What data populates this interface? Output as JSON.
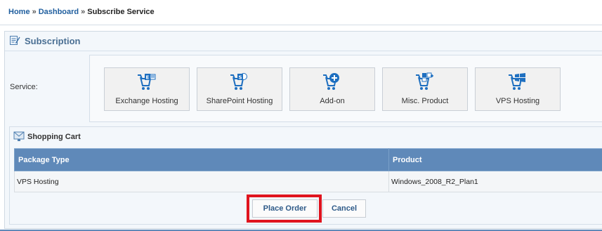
{
  "breadcrumb": {
    "home": "Home",
    "sep1": "»",
    "dashboard": "Dashboard",
    "sep2": "»",
    "current": "Subscribe Service"
  },
  "subscription": {
    "title": "Subscription",
    "service_label": "Service:",
    "tiles": [
      {
        "label": "Exchange Hosting",
        "icon": "exchange-cart-icon"
      },
      {
        "label": "SharePoint Hosting",
        "icon": "sharepoint-cart-icon"
      },
      {
        "label": "Add-on",
        "icon": "addon-cart-icon"
      },
      {
        "label": "Misc. Product",
        "icon": "misc-product-cart-icon"
      },
      {
        "label": "VPS Hosting",
        "icon": "vps-cart-icon"
      }
    ]
  },
  "cart": {
    "title": "Shopping Cart",
    "columns": [
      "Package Type",
      "Product"
    ],
    "rows": [
      [
        "VPS Hosting",
        "Windows_2008_R2_Plan1"
      ]
    ]
  },
  "actions": {
    "place_order": "Place Order",
    "cancel": "Cancel"
  },
  "colors": {
    "link": "#1f5e9e",
    "table_header": "#5f89b9",
    "highlight": "#e0141e",
    "icon_blue": "#1e6fc0"
  }
}
